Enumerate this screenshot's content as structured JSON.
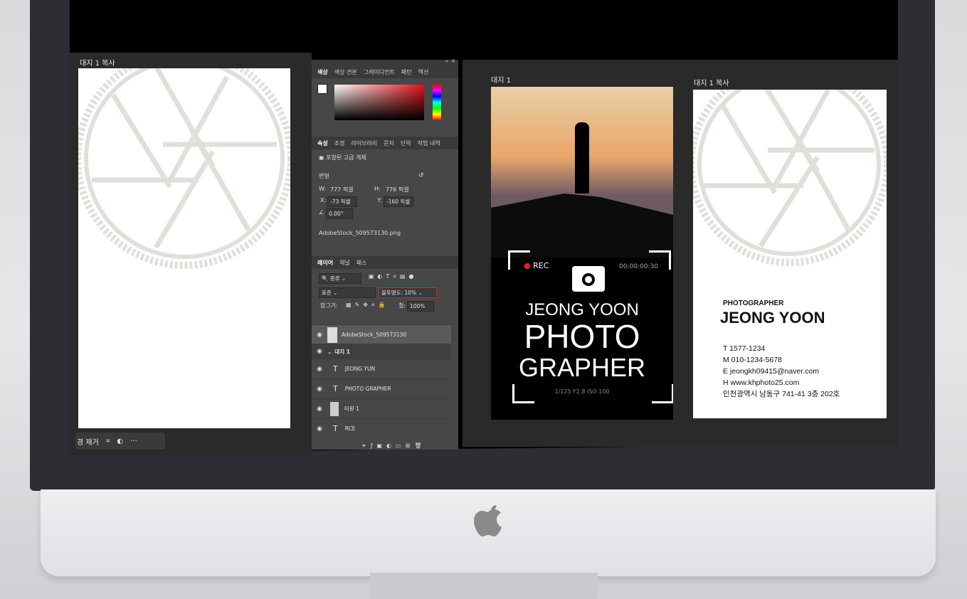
{
  "left_artboard": {
    "label": "대지 1 복사"
  },
  "toolbar": {
    "remove_label": "경 제거",
    "more": "···"
  },
  "color_panel": {
    "tabs": [
      "색상",
      "색상 견본",
      "그레이디언트",
      "패턴",
      "액션"
    ]
  },
  "properties_panel": {
    "tabs": [
      "속성",
      "조정",
      "라이브러리",
      "문자",
      "단락",
      "작업 내역"
    ],
    "object_type": "포함된 고급 개체",
    "section": "변형",
    "w_label": "W:",
    "w_value": "777 픽셀",
    "h_label": "H:",
    "h_value": "776 픽셀",
    "x_label": "X:",
    "x_value": "-73 픽셀",
    "y_label": "Y:",
    "y_value": "-160 픽셀",
    "angle_value": "0.00°",
    "filename": "AdobeStock_509573130.png"
  },
  "layers_panel": {
    "tabs": [
      "레이어",
      "채널",
      "패스"
    ],
    "filter_label": "종류",
    "blend_mode": "표준",
    "opacity_label": "불투명도:",
    "opacity_value": "10%",
    "lock_label": "잠그기:",
    "fill_label": "칠:",
    "fill_value": "100%",
    "layers": [
      {
        "name": "AdobeStock_509573130"
      },
      {
        "name": "대지 1"
      },
      {
        "name": "JEONG YUN"
      },
      {
        "name": "PHOTO GRAPHER"
      },
      {
        "name": "타원 1"
      },
      {
        "name": "RCE"
      }
    ]
  },
  "artboard1": {
    "label": "대지 1",
    "rec": "REC",
    "timecode": "00:00:00:30",
    "name": "JEONG YOON",
    "title1": "PHOTO",
    "title2": "GRAPHER",
    "settings": "1/125   F2.8   ISO 100"
  },
  "artboard2": {
    "label": "대지 1 복사",
    "role": "PHOTOGRAPHER",
    "name": "JEONG YOON",
    "phone": "T 1577-1234",
    "mobile": "M 010-1234-5678",
    "email": "E jeongkh09415@naver.com",
    "homepage": "H www.khphoto25.com",
    "address": "인천광역시 남동구 741-41 3층 202호"
  }
}
